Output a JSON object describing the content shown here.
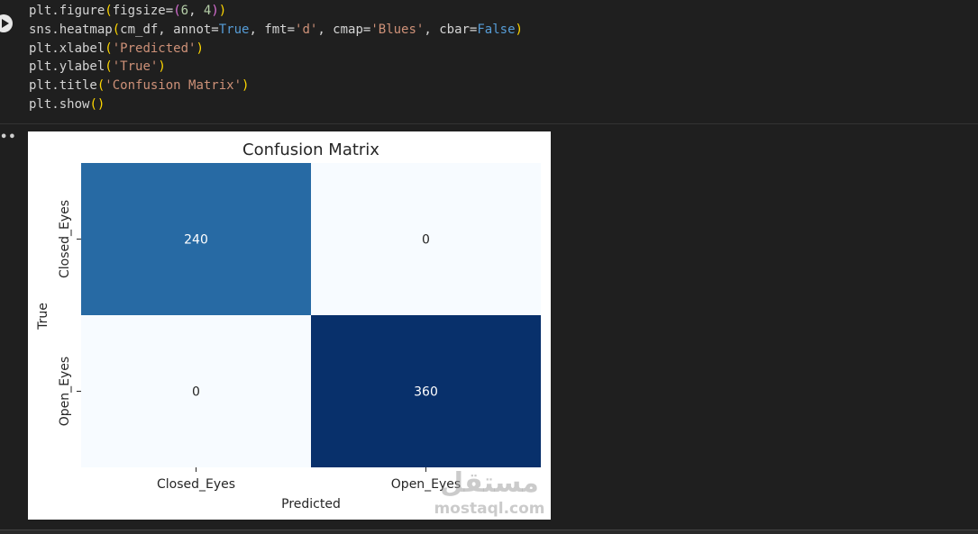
{
  "code_cell": {
    "lines": [
      [
        "plt.figure",
        "(",
        "figsize",
        "=",
        "(",
        "6",
        ", ",
        "4",
        ")",
        ")"
      ],
      [
        "sns.heatmap",
        "(",
        "cm_df, annot=",
        "True",
        ", fmt=",
        "'d'",
        ", cmap=",
        "'Blues'",
        ", cbar=",
        "False",
        ")"
      ],
      [
        "plt.xlabel",
        "(",
        "'Predicted'",
        ")"
      ],
      [
        "plt.ylabel",
        "(",
        "'True'",
        ")"
      ],
      [
        "plt.title",
        "(",
        "'Confusion Matrix'",
        ")"
      ],
      [
        "plt.show",
        "(",
        ")"
      ]
    ]
  },
  "output": {
    "marker": "••"
  },
  "chart_data": {
    "type": "heatmap",
    "title": "Confusion Matrix",
    "xlabel": "Predicted",
    "ylabel": "True",
    "x_categories": [
      "Closed_Eyes",
      "Open_Eyes"
    ],
    "y_categories": [
      "Closed_Eyes",
      "Open_Eyes"
    ],
    "values": [
      [
        240,
        0
      ],
      [
        0,
        360
      ]
    ],
    "cmap": "Blues",
    "colorbar": false,
    "colors": {
      "low": "#f7fbff",
      "mid": "#3787c0",
      "high": "#08306b",
      "text_light": "#ffffff",
      "text_dark": "#262626"
    }
  },
  "watermark": {
    "arabic": "مستقل",
    "latin": "mostaql.com"
  }
}
